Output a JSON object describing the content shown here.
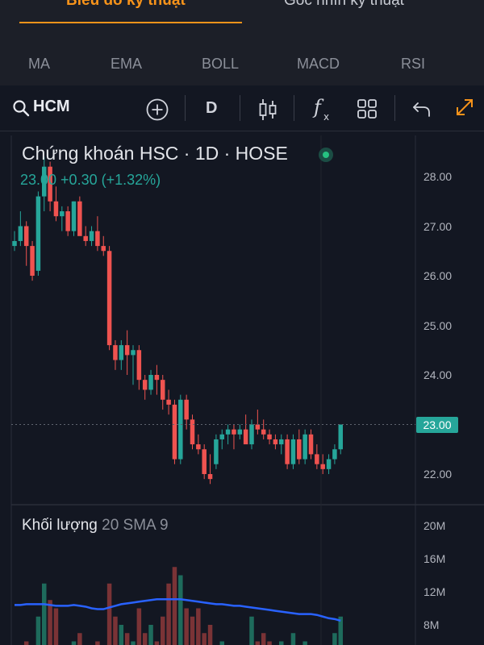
{
  "tabs": [
    {
      "label": "Biểu đồ kỹ thuật",
      "active": true
    },
    {
      "label": "Góc nhìn kỹ thuật",
      "active": false
    }
  ],
  "indicators": [
    "MA",
    "EMA",
    "BOLL",
    "MACD",
    "RSI"
  ],
  "toolbar": {
    "symbol": "HCM",
    "interval": "D",
    "icons": [
      "search-icon",
      "add-circle-icon",
      "candlestick-icon",
      "function-icon",
      "grid-icon",
      "undo-icon",
      "expand-icon"
    ]
  },
  "chart": {
    "title": "Chứng khoán HSC · 1D · HOSE",
    "ohlc": "23.00 +0.30 (+1.32%)",
    "last_price": "23.00",
    "price_axis": [
      "28.00",
      "27.00",
      "26.00",
      "25.00",
      "24.00",
      "23.00",
      "22.00"
    ],
    "volume_title": "Khối lượng",
    "volume_params": "20 SMA 9",
    "volume_axis": [
      "20M",
      "16M",
      "12M",
      "8M"
    ],
    "colors": {
      "up": "#26a69a",
      "down": "#ef5350",
      "sma": "#2962ff",
      "accent": "#f7931a",
      "background": "#131722"
    }
  },
  "chart_data": {
    "type": "candlestick",
    "ylim": [
      21.5,
      28.4
    ],
    "candles": [
      [
        26.6,
        26.9,
        26.5,
        26.7
      ],
      [
        26.7,
        27.3,
        26.6,
        27.0
      ],
      [
        27.0,
        27.1,
        26.2,
        26.6
      ],
      [
        26.6,
        26.7,
        25.9,
        26.0
      ],
      [
        26.1,
        27.7,
        26.0,
        27.6
      ],
      [
        27.6,
        28.4,
        27.3,
        28.2
      ],
      [
        28.2,
        28.3,
        27.3,
        27.5
      ],
      [
        27.5,
        27.8,
        27.1,
        27.2
      ],
      [
        27.2,
        27.4,
        26.9,
        27.3
      ],
      [
        27.3,
        27.4,
        26.8,
        26.9
      ],
      [
        26.9,
        27.5,
        26.8,
        27.5
      ],
      [
        27.5,
        27.6,
        26.9,
        26.8
      ],
      [
        26.8,
        27.0,
        26.6,
        26.7
      ],
      [
        26.7,
        27.0,
        26.6,
        26.9
      ],
      [
        26.9,
        27.2,
        26.5,
        26.6
      ],
      [
        26.6,
        26.8,
        26.4,
        26.5
      ],
      [
        26.5,
        26.6,
        24.5,
        24.6
      ],
      [
        24.6,
        24.7,
        24.1,
        24.3
      ],
      [
        24.3,
        24.7,
        24.1,
        24.6
      ],
      [
        24.6,
        24.9,
        24.0,
        24.4
      ],
      [
        24.4,
        24.6,
        23.8,
        24.5
      ],
      [
        24.5,
        24.6,
        23.7,
        23.9
      ],
      [
        23.9,
        24.0,
        23.5,
        23.7
      ],
      [
        23.7,
        24.1,
        23.6,
        24.0
      ],
      [
        24.0,
        24.2,
        23.6,
        23.9
      ],
      [
        23.9,
        24.0,
        23.3,
        23.5
      ],
      [
        23.5,
        23.7,
        23.2,
        23.4
      ],
      [
        23.4,
        23.5,
        22.2,
        22.3
      ],
      [
        22.3,
        23.6,
        22.2,
        23.5
      ],
      [
        23.5,
        23.6,
        22.9,
        23.1
      ],
      [
        23.1,
        23.2,
        22.5,
        22.6
      ],
      [
        22.6,
        22.8,
        22.4,
        22.5
      ],
      [
        22.5,
        22.6,
        21.9,
        22.0
      ],
      [
        22.0,
        22.4,
        21.8,
        21.9
      ],
      [
        22.2,
        22.8,
        22.1,
        22.7
      ],
      [
        22.7,
        22.9,
        22.5,
        22.8
      ],
      [
        22.8,
        23.0,
        22.6,
        22.9
      ],
      [
        22.9,
        23.0,
        22.5,
        22.8
      ],
      [
        22.8,
        23.0,
        22.7,
        22.9
      ],
      [
        22.9,
        23.2,
        22.7,
        22.6
      ],
      [
        22.6,
        23.1,
        22.5,
        23.0
      ],
      [
        23.0,
        23.3,
        22.8,
        22.9
      ],
      [
        22.9,
        23.1,
        22.7,
        22.8
      ],
      [
        22.8,
        22.9,
        22.6,
        22.7
      ],
      [
        22.7,
        22.8,
        22.5,
        22.6
      ],
      [
        22.6,
        22.8,
        22.4,
        22.7
      ],
      [
        22.7,
        22.8,
        22.1,
        22.2
      ],
      [
        22.2,
        22.8,
        22.1,
        22.7
      ],
      [
        22.7,
        22.9,
        22.2,
        22.3
      ],
      [
        22.3,
        22.9,
        22.2,
        22.8
      ],
      [
        22.8,
        22.9,
        22.3,
        22.4
      ],
      [
        22.4,
        22.6,
        22.1,
        22.2
      ],
      [
        22.2,
        22.4,
        22.0,
        22.1
      ],
      [
        22.1,
        22.4,
        22.0,
        22.3
      ],
      [
        22.3,
        22.6,
        22.2,
        22.5
      ],
      [
        22.5,
        23.0,
        22.4,
        23.0
      ]
    ],
    "volume": [
      4,
      5,
      6,
      4,
      9,
      13,
      11,
      10,
      5,
      4,
      6,
      7,
      5,
      5,
      6,
      3,
      13,
      9,
      8,
      7,
      6,
      10,
      7,
      8,
      6,
      9,
      13,
      15,
      14,
      10,
      9,
      10,
      7,
      8,
      5,
      6,
      4,
      5,
      3,
      5,
      9,
      6,
      7,
      6,
      4,
      6,
      4,
      7,
      5,
      6,
      4,
      5,
      4,
      5,
      7,
      9
    ],
    "sma": [
      10.4,
      10.4,
      10.5,
      10.5,
      10.5,
      10.5,
      10.4,
      10.3,
      10.3,
      10.3,
      10.4,
      10.3,
      10.2,
      10.0,
      9.9,
      9.9,
      10.1,
      10.3,
      10.5,
      10.6,
      10.7,
      10.8,
      10.9,
      11.0,
      11.1,
      11.1,
      11.1,
      11.1,
      11.1,
      11.0,
      10.9,
      10.8,
      10.7,
      10.6,
      10.5,
      10.5,
      10.4,
      10.3,
      10.3,
      10.2,
      10.1,
      10.0,
      9.9,
      9.8,
      9.7,
      9.6,
      9.5,
      9.4,
      9.3,
      9.3,
      9.3,
      9.2,
      9.0,
      8.8,
      8.7,
      8.5
    ]
  }
}
